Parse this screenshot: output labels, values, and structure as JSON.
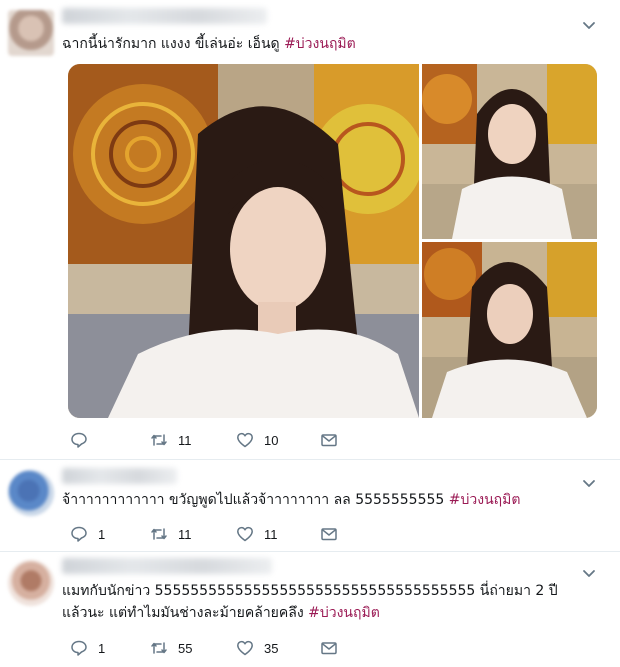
{
  "tweets": [
    {
      "text": "ฉากนี้น่ารักมาก แงงง ขี้เล่นอ่ะ เอ็นดู ",
      "hashtag": "#บ่วงนฤมิต",
      "reply_count": "",
      "retweet_count": "11",
      "like_count": "10",
      "photos": [
        "main-photo",
        "top-right-photo",
        "bottom-right-photo"
      ]
    },
    {
      "text": "จ้าาาาาาาาาาาา ขวัญพูดไปแล้วจ้าาาาาาาา ลล 5555555555 ",
      "hashtag": "#บ่วงนฤมิต",
      "reply_count": "1",
      "retweet_count": "11",
      "like_count": "11"
    },
    {
      "text": "แมทกับนักข่าว 555555555555555555555555555555555555 นี่ถ่ายมา 2 ปีแล้วนะ แต่ทำไมมันช่างละม้ายคล้ายคลึง ",
      "hashtag": "#บ่วงนฤมิต",
      "reply_count": "1",
      "retweet_count": "55",
      "like_count": "35"
    }
  ],
  "icons": {
    "reply": "reply-icon",
    "retweet": "retweet-icon",
    "like": "like-icon",
    "message": "message-icon",
    "more": "chevron-down-icon"
  },
  "colors": {
    "hashtag": "#9b1b55",
    "icon": "#657786",
    "divider": "#e6ecf0"
  }
}
